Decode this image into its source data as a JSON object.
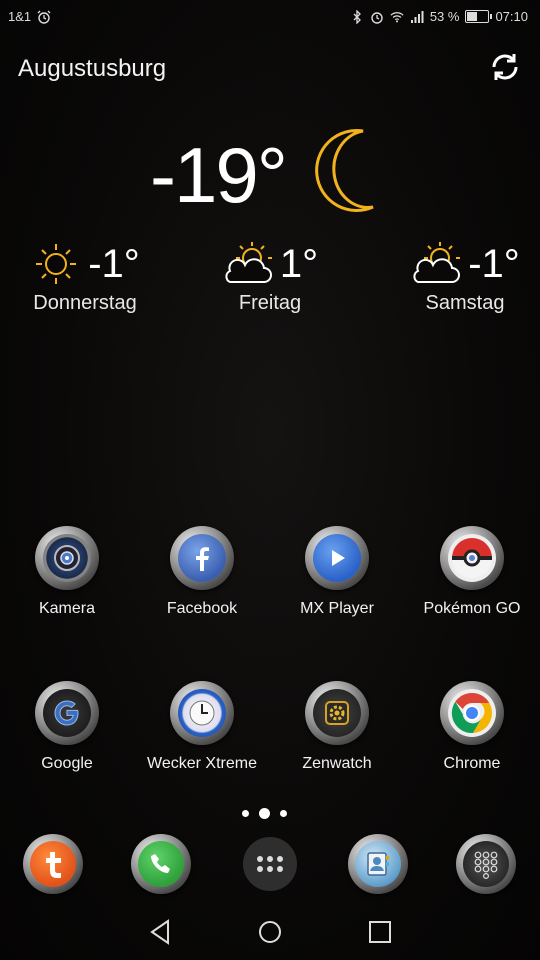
{
  "status": {
    "carrier": "1&1",
    "battery": "53 %",
    "battery_level": 0.53,
    "time": "07:10"
  },
  "weather": {
    "location": "Augustusburg",
    "current_temp": "-19°",
    "forecast": [
      {
        "temp": "-1°",
        "day": "Donnerstag",
        "icon": "sun-icon"
      },
      {
        "temp": "1°",
        "day": "Freitag",
        "icon": "sun-cloud-icon"
      },
      {
        "temp": "-1°",
        "day": "Samstag",
        "icon": "sun-cloud-icon"
      }
    ]
  },
  "apps": [
    {
      "label": "Kamera",
      "icon": "camera-icon"
    },
    {
      "label": "Facebook",
      "icon": "facebook-icon"
    },
    {
      "label": "MX Player",
      "icon": "play-icon"
    },
    {
      "label": "Pokémon GO",
      "icon": "pokeball-icon"
    },
    {
      "label": "Google",
      "icon": "google-icon"
    },
    {
      "label": "Wecker Xtreme",
      "icon": "clock-icon"
    },
    {
      "label": "Zenwatch",
      "icon": "watch-gear-icon"
    },
    {
      "label": "Chrome",
      "icon": "chrome-icon"
    }
  ],
  "dock": [
    {
      "icon": "t-app-icon"
    },
    {
      "icon": "phone-icon"
    },
    {
      "icon": "app-drawer-icon"
    },
    {
      "icon": "contacts-icon"
    },
    {
      "icon": "dialpad-icon"
    }
  ],
  "colors": {
    "accent_moon": "#f2b21d",
    "sun": "#f2b21d"
  }
}
